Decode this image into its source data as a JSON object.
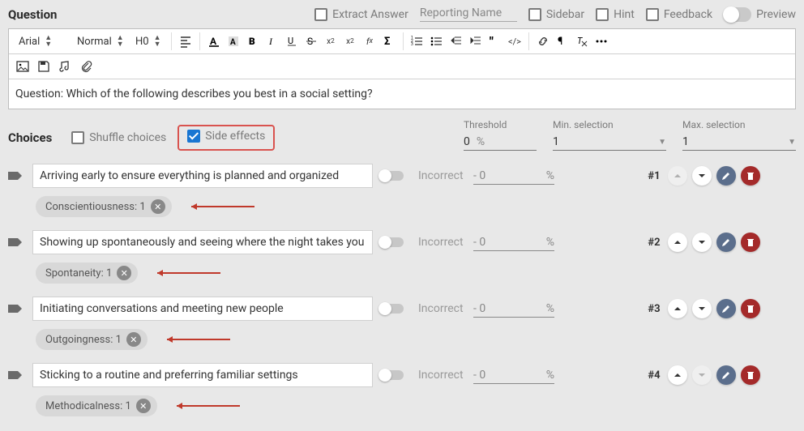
{
  "header": {
    "question_label": "Question",
    "extract_answer": "Extract Answer",
    "reporting_name_placeholder": "Reporting Name",
    "sidebar": "Sidebar",
    "hint": "Hint",
    "feedback": "Feedback",
    "preview": "Preview"
  },
  "toolbar": {
    "font": "Arial",
    "format": "Normal",
    "heading": "H0"
  },
  "question_body": "Question: Which of the following describes you best in a social setting?",
  "choices_header": {
    "title": "Choices",
    "shuffle": "Shuffle choices",
    "side_effects": "Side effects",
    "threshold_label": "Threshold",
    "threshold_value": "0",
    "threshold_unit": "%",
    "min_label": "Min. selection",
    "min_value": "1",
    "max_label": "Max. selection",
    "max_value": "1"
  },
  "choice_labels": {
    "incorrect": "Incorrect",
    "minus_zero": "- 0",
    "pct": "%"
  },
  "choices": [
    {
      "text": "Arriving early to ensure everything is planned and organized",
      "side_effect": "Conscientiousness: 1",
      "order": "#1",
      "up_disabled": true,
      "down_disabled": false
    },
    {
      "text": "Showing up spontaneously and seeing where the night takes you",
      "side_effect": "Spontaneity: 1",
      "order": "#2",
      "up_disabled": false,
      "down_disabled": false
    },
    {
      "text": "Initiating conversations and meeting new people",
      "side_effect": "Outgoingness: 1",
      "order": "#3",
      "up_disabled": false,
      "down_disabled": false
    },
    {
      "text": "Sticking to a routine and preferring familiar settings",
      "side_effect": "Methodicalness: 1",
      "order": "#4",
      "up_disabled": false,
      "down_disabled": true
    }
  ]
}
